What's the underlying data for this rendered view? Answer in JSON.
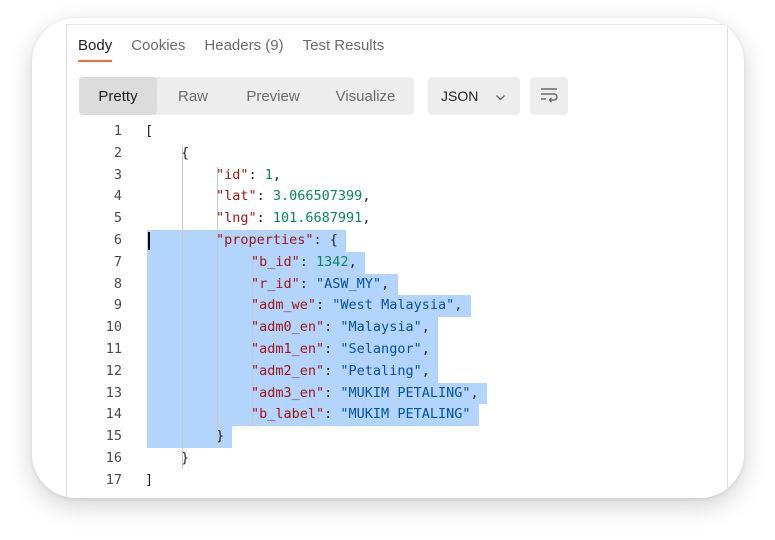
{
  "tabs": [
    {
      "label": "Body",
      "active": true
    },
    {
      "label": "Cookies",
      "active": false
    },
    {
      "label": "Headers (9)",
      "active": false
    },
    {
      "label": "Test Results",
      "active": false
    }
  ],
  "view_modes": [
    {
      "label": "Pretty",
      "active": true
    },
    {
      "label": "Raw",
      "active": false
    },
    {
      "label": "Preview",
      "active": false
    },
    {
      "label": "Visualize",
      "active": false
    }
  ],
  "format": {
    "selected": "JSON"
  },
  "icons": {
    "format_chevron": "chevron-down-icon",
    "wrap": "wrap-lines-icon"
  },
  "colors": {
    "accent": "#ff6c37",
    "selection": "#b3d4fc",
    "key": "#a31515",
    "string": "#0451a5",
    "number": "#098658"
  },
  "code_lines": [
    {
      "num": "1",
      "indent": 0,
      "sel": false,
      "parts": [
        {
          "t": "[",
          "c": "p"
        }
      ]
    },
    {
      "num": "2",
      "indent": 1,
      "sel": false,
      "parts": [
        {
          "t": "{",
          "c": "p"
        }
      ]
    },
    {
      "num": "3",
      "indent": 2,
      "sel": false,
      "parts": [
        {
          "t": "\"id\"",
          "c": "k"
        },
        {
          "t": ": ",
          "c": "p"
        },
        {
          "t": "1",
          "c": "n"
        },
        {
          "t": ",",
          "c": "p"
        }
      ]
    },
    {
      "num": "4",
      "indent": 2,
      "sel": false,
      "parts": [
        {
          "t": "\"lat\"",
          "c": "k"
        },
        {
          "t": ": ",
          "c": "p"
        },
        {
          "t": "3.066507399",
          "c": "n"
        },
        {
          "t": ",",
          "c": "p"
        }
      ]
    },
    {
      "num": "5",
      "indent": 2,
      "sel": false,
      "parts": [
        {
          "t": "\"lng\"",
          "c": "k"
        },
        {
          "t": ": ",
          "c": "p"
        },
        {
          "t": "101.6687991",
          "c": "n"
        },
        {
          "t": ",",
          "c": "p"
        }
      ]
    },
    {
      "num": "6",
      "indent": 2,
      "sel": true,
      "parts": [
        {
          "t": "\"properties\"",
          "c": "k"
        },
        {
          "t": ": {",
          "c": "p"
        }
      ]
    },
    {
      "num": "7",
      "indent": 3,
      "sel": true,
      "parts": [
        {
          "t": "\"b_id\"",
          "c": "k"
        },
        {
          "t": ": ",
          "c": "p"
        },
        {
          "t": "1342",
          "c": "n"
        },
        {
          "t": ",",
          "c": "p"
        }
      ]
    },
    {
      "num": "8",
      "indent": 3,
      "sel": true,
      "parts": [
        {
          "t": "\"r_id\"",
          "c": "k"
        },
        {
          "t": ": ",
          "c": "p"
        },
        {
          "t": "\"ASW_MY\"",
          "c": "s"
        },
        {
          "t": ",",
          "c": "p"
        }
      ]
    },
    {
      "num": "9",
      "indent": 3,
      "sel": true,
      "parts": [
        {
          "t": "\"adm_we\"",
          "c": "k"
        },
        {
          "t": ": ",
          "c": "p"
        },
        {
          "t": "\"West Malaysia\"",
          "c": "s"
        },
        {
          "t": ",",
          "c": "p"
        }
      ]
    },
    {
      "num": "10",
      "indent": 3,
      "sel": true,
      "parts": [
        {
          "t": "\"adm0_en\"",
          "c": "k"
        },
        {
          "t": ": ",
          "c": "p"
        },
        {
          "t": "\"Malaysia\"",
          "c": "s"
        },
        {
          "t": ",",
          "c": "p"
        }
      ]
    },
    {
      "num": "11",
      "indent": 3,
      "sel": true,
      "parts": [
        {
          "t": "\"adm1_en\"",
          "c": "k"
        },
        {
          "t": ": ",
          "c": "p"
        },
        {
          "t": "\"Selangor\"",
          "c": "s"
        },
        {
          "t": ",",
          "c": "p"
        }
      ]
    },
    {
      "num": "12",
      "indent": 3,
      "sel": true,
      "parts": [
        {
          "t": "\"adm2_en\"",
          "c": "k"
        },
        {
          "t": ": ",
          "c": "p"
        },
        {
          "t": "\"Petaling\"",
          "c": "s"
        },
        {
          "t": ",",
          "c": "p"
        }
      ]
    },
    {
      "num": "13",
      "indent": 3,
      "sel": true,
      "parts": [
        {
          "t": "\"adm3_en\"",
          "c": "k"
        },
        {
          "t": ": ",
          "c": "p"
        },
        {
          "t": "\"MUKIM PETALING\"",
          "c": "s"
        },
        {
          "t": ",",
          "c": "p"
        }
      ]
    },
    {
      "num": "14",
      "indent": 3,
      "sel": true,
      "parts": [
        {
          "t": "\"b_label\"",
          "c": "k"
        },
        {
          "t": ": ",
          "c": "p"
        },
        {
          "t": "\"MUKIM PETALING\"",
          "c": "s"
        }
      ]
    },
    {
      "num": "15",
      "indent": 2,
      "sel": true,
      "parts": [
        {
          "t": "}",
          "c": "p"
        }
      ]
    },
    {
      "num": "16",
      "indent": 1,
      "sel": false,
      "parts": [
        {
          "t": "}",
          "c": "p"
        }
      ]
    },
    {
      "num": "17",
      "indent": 0,
      "sel": false,
      "parts": [
        {
          "t": "]",
          "c": "p"
        }
      ]
    }
  ]
}
